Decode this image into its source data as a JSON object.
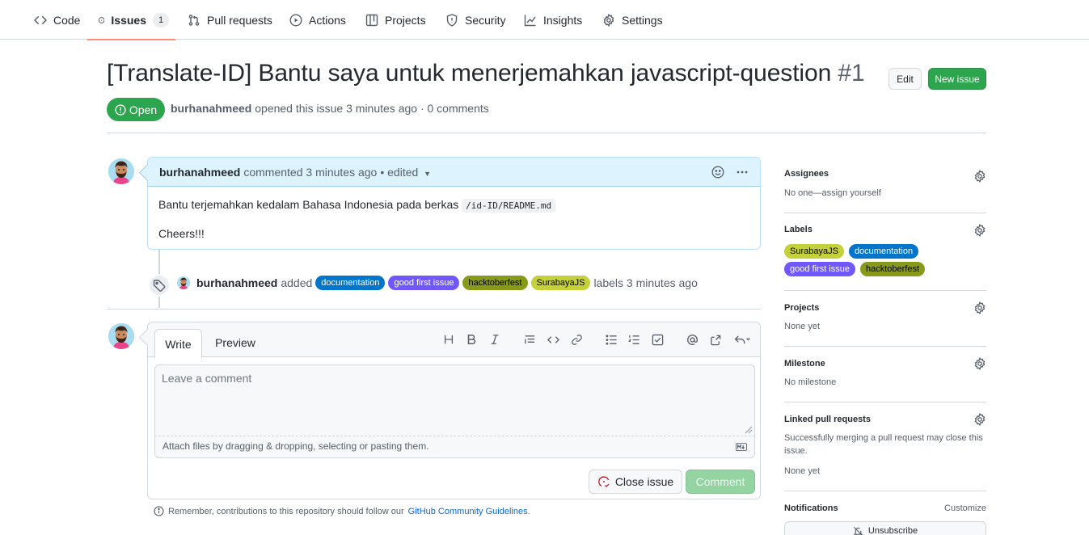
{
  "nav": {
    "tabs": [
      {
        "label": "Code",
        "icon": "code-icon"
      },
      {
        "label": "Issues",
        "icon": "issue-opened-icon",
        "count": "1",
        "selected": true
      },
      {
        "label": "Pull requests",
        "icon": "git-pull-request-icon"
      },
      {
        "label": "Actions",
        "icon": "play-icon"
      },
      {
        "label": "Projects",
        "icon": "table-icon"
      },
      {
        "label": "Security",
        "icon": "shield-icon"
      },
      {
        "label": "Insights",
        "icon": "graph-icon"
      },
      {
        "label": "Settings",
        "icon": "gear-icon"
      }
    ]
  },
  "issue": {
    "title": "[Translate-ID] Bantu saya untuk menerjemahkan javascript-question",
    "number": "#1",
    "state": "Open",
    "author": "burhanahmeed",
    "meta": "opened this issue 3 minutes ago · 0 comments",
    "edit_label": "Edit",
    "new_issue_label": "New issue"
  },
  "comment": {
    "author": "burhanahmeed",
    "meta": "commented 3 minutes ago",
    "edited": "• edited",
    "body_text": "Bantu terjemahkan kedalam Bahasa Indonesia pada berkas",
    "body_code": "/id-ID/README.md",
    "body_p2": "Cheers!!!"
  },
  "event": {
    "author": "burhanahmeed",
    "action": "added",
    "suffix": "labels 3 minutes ago",
    "labels": [
      {
        "name": "documentation",
        "bg": "#0075ca",
        "fg": "#ffffff"
      },
      {
        "name": "good first issue",
        "bg": "#7057ff",
        "fg": "#ffffff"
      },
      {
        "name": "hacktoberfest",
        "bg": "#889a1b",
        "fg": "#000000"
      },
      {
        "name": "SurabayaJS",
        "bg": "#c5d13b",
        "fg": "#000000"
      }
    ]
  },
  "form": {
    "tab_write": "Write",
    "tab_preview": "Preview",
    "placeholder": "Leave a comment",
    "attach_text": "Attach files by dragging & dropping, selecting or pasting them.",
    "close_label": "Close issue",
    "comment_label": "Comment",
    "guidelines_prefix": "Remember, contributions to this repository should follow our",
    "guidelines_link": "GitHub Community Guidelines",
    "guidelines_suffix": "."
  },
  "sidebar": {
    "assignees": {
      "title": "Assignees",
      "text": "No one—assign yourself"
    },
    "labels": {
      "title": "Labels",
      "items": [
        {
          "name": "SurabayaJS",
          "bg": "#c5d13b",
          "fg": "#000000"
        },
        {
          "name": "documentation",
          "bg": "#0075ca",
          "fg": "#ffffff"
        },
        {
          "name": "good first issue",
          "bg": "#7057ff",
          "fg": "#ffffff"
        },
        {
          "name": "hacktoberfest",
          "bg": "#889a1b",
          "fg": "#000000"
        }
      ]
    },
    "projects": {
      "title": "Projects",
      "text": "None yet"
    },
    "milestone": {
      "title": "Milestone",
      "text": "No milestone"
    },
    "linked": {
      "title": "Linked pull requests",
      "text": "Successfully merging a pull request may close this issue.",
      "text2": "None yet"
    },
    "notifications": {
      "title": "Notifications",
      "customize": "Customize",
      "unsubscribe": "Unsubscribe"
    }
  },
  "colors": {
    "accent_green": "#2da44e",
    "nav_underline": "#fd8c73",
    "link_blue": "#0969da",
    "comment_header_bg": "#ddf4ff"
  }
}
